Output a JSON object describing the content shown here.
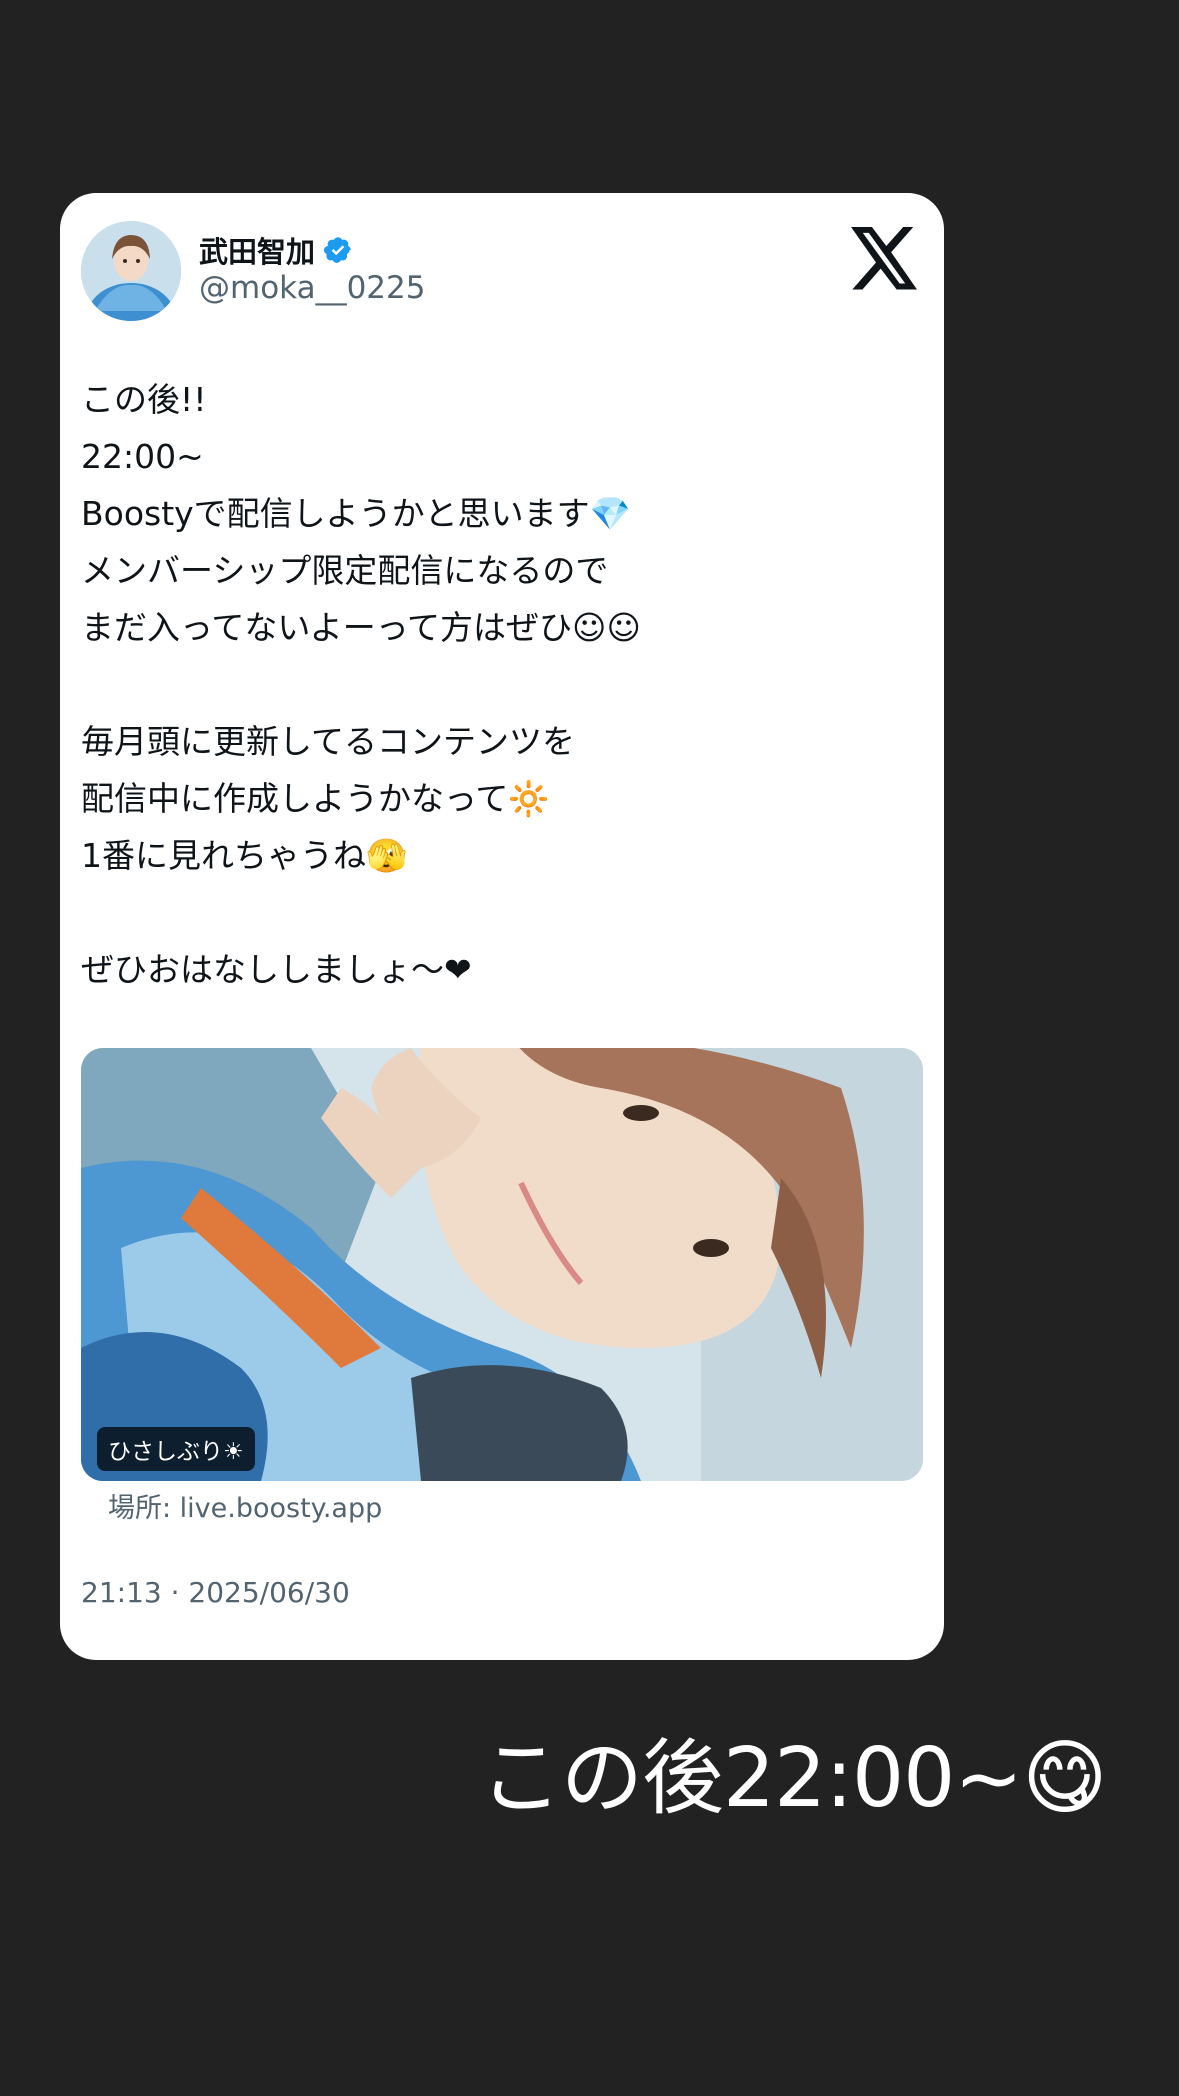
{
  "tweet": {
    "author_name": "武田智加",
    "author_handle": "@moka__0225",
    "verified_icon": "verified-badge-icon",
    "brand_icon": "x-logo-icon",
    "text_lines": [
      "この後!!",
      "22:00~",
      "Boostyで配信しようかと思います💎",
      "メンバーシップ限定配信になるので",
      "まだ入ってないよーって方はぜひ☺︎☺︎",
      "",
      "毎月頭に更新してるコンテンツを",
      "配信中に作成しようかなって🔆",
      "1番に見れちゃうね🫣",
      "",
      "ぜひおはなししましょ〜❤︎"
    ],
    "media_badge": "ひさしぶり☀︎",
    "location": "場所: live.boosty.app",
    "timestamp": "21:13 · 2025/06/30"
  },
  "story": {
    "caption": "この後22:00~😋"
  },
  "colors": {
    "background": "#222222",
    "card": "#ffffff",
    "text": "#0f1419",
    "muted": "#536471",
    "verified": "#1d9bf0"
  }
}
